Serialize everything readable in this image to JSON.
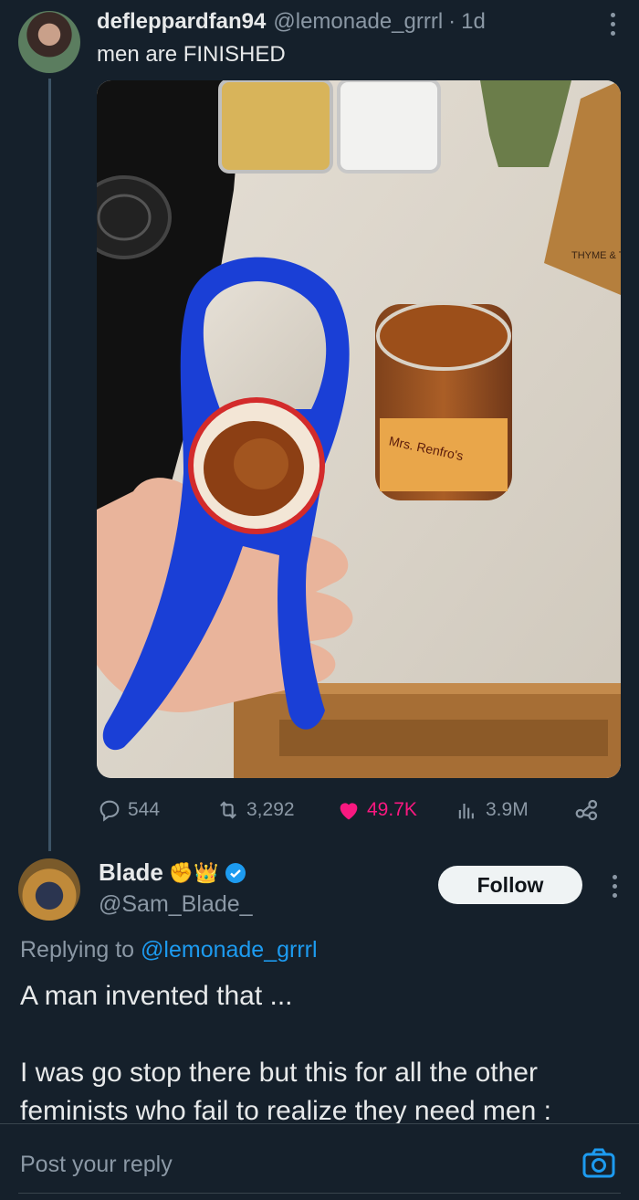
{
  "post": {
    "display_name": "defleppardfan94",
    "handle": "@lemonade_grrrl",
    "time": "1d",
    "text": "men are FINISHED",
    "image_label": "THYME & TABLE",
    "jar_label": "Mrs. Renfro's"
  },
  "actions": {
    "replies": "544",
    "reposts": "3,292",
    "likes": "49.7K",
    "views": "3.9M",
    "like_color": "#f91880"
  },
  "reply": {
    "display_name": "Blade",
    "badges": "✊👑",
    "handle": "@Sam_Blade_",
    "follow_label": "Follow",
    "replying_prefix": "Replying to ",
    "replying_handle": "@lemonade_grrrl",
    "line1": "A man invented that ...",
    "line2": "I was go stop there but this for all the other",
    "line3": "feminists who fail to realize they need men :"
  },
  "composer": {
    "placeholder": "Post your reply"
  },
  "colors": {
    "background": "#15202b",
    "accent": "#1d9bf0",
    "muted": "#8b98a5"
  }
}
